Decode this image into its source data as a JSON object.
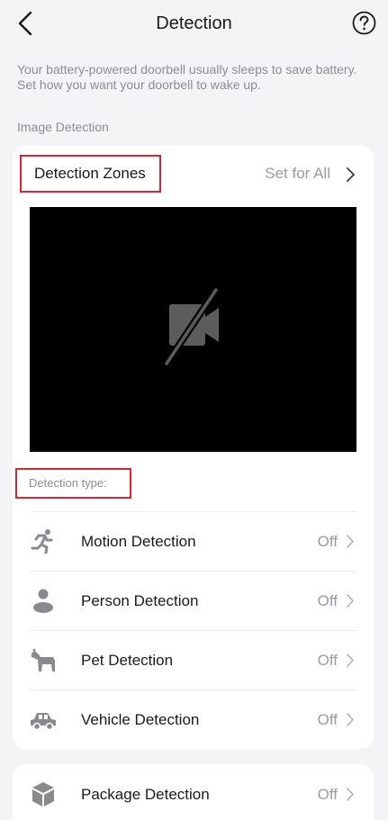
{
  "header": {
    "title": "Detection",
    "back_icon": "chevron-left-icon",
    "help_icon": "question-circle-icon"
  },
  "intro_text": "Your battery-powered doorbell usually sleeps to save battery. Set how you want your doorbell to wake up.",
  "image_detection": {
    "section_label": "Image Detection",
    "zones_title": "Detection Zones",
    "set_for_all_label": "Set for All",
    "preview_icon": "camera-off-icon",
    "detection_type_label": "Detection type:",
    "items": [
      {
        "label": "Motion Detection",
        "status": "Off",
        "icon": "running-person-icon"
      },
      {
        "label": "Person Detection",
        "status": "Off",
        "icon": "person-icon"
      },
      {
        "label": "Pet Detection",
        "status": "Off",
        "icon": "dog-icon"
      },
      {
        "label": "Vehicle Detection",
        "status": "Off",
        "icon": "car-icon"
      }
    ]
  },
  "package": {
    "label": "Package Detection",
    "status": "Off",
    "icon": "package-box-icon"
  },
  "colors": {
    "background": "#f4f4f6",
    "card": "#ffffff",
    "highlight_border": "#d6252f",
    "secondary_text": "#8d8d93",
    "icon_gray": "#8a8a8e"
  }
}
